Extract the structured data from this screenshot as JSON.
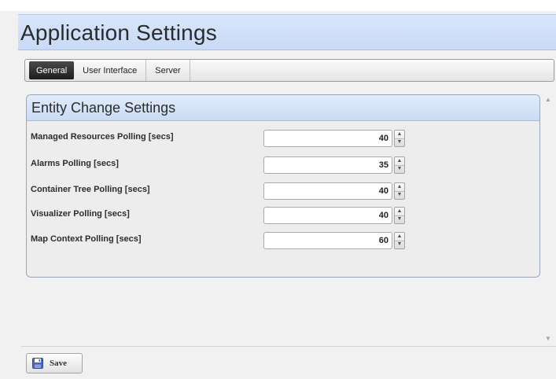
{
  "page": {
    "title": "Application Settings"
  },
  "tabs": [
    {
      "label": "General",
      "active": true
    },
    {
      "label": "User Interface",
      "active": false
    },
    {
      "label": "Server",
      "active": false
    }
  ],
  "panel": {
    "title": "Entity Change Settings",
    "rows": [
      {
        "label": "Managed Resources Polling [secs]",
        "value": "40"
      },
      {
        "label": "Alarms Polling [secs]",
        "value": "35"
      },
      {
        "label": "Container Tree Polling [secs]",
        "value": "40"
      },
      {
        "label": "Visualizer Polling [secs]",
        "value": "40"
      },
      {
        "label": "Map Context Polling [secs]",
        "value": "60"
      }
    ]
  },
  "footer": {
    "save_label": "Save"
  },
  "icons": {
    "save": "save-icon",
    "spin_up": "chevron-up-icon",
    "spin_down": "chevron-down-icon",
    "scroll_up": "scroll-up-arrow-icon",
    "scroll_down": "scroll-down-arrow-icon"
  },
  "colors": {
    "header_blue": "#c8daf6",
    "active_tab": "#1d1d1d"
  }
}
